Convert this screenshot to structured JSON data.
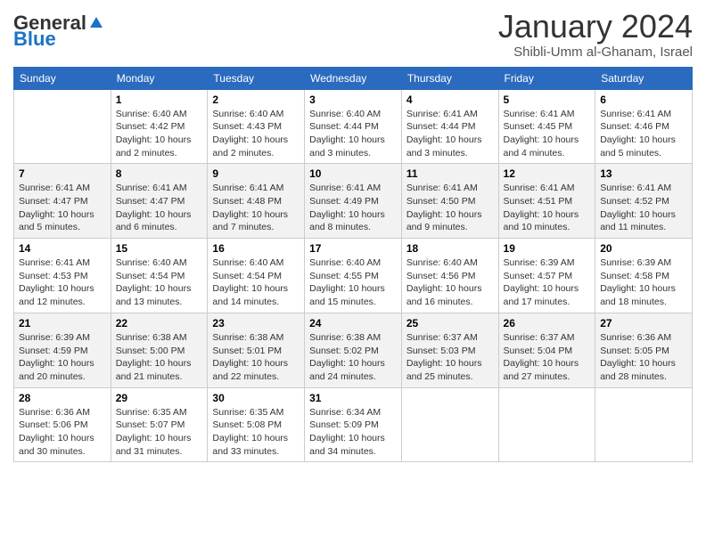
{
  "header": {
    "logo_general": "General",
    "logo_blue": "Blue",
    "month_title": "January 2024",
    "location": "Shibli-Umm al-Ghanam, Israel"
  },
  "days_of_week": [
    "Sunday",
    "Monday",
    "Tuesday",
    "Wednesday",
    "Thursday",
    "Friday",
    "Saturday"
  ],
  "weeks": [
    [
      {
        "day": "",
        "info": ""
      },
      {
        "day": "1",
        "info": "Sunrise: 6:40 AM\nSunset: 4:42 PM\nDaylight: 10 hours\nand 2 minutes."
      },
      {
        "day": "2",
        "info": "Sunrise: 6:40 AM\nSunset: 4:43 PM\nDaylight: 10 hours\nand 2 minutes."
      },
      {
        "day": "3",
        "info": "Sunrise: 6:40 AM\nSunset: 4:44 PM\nDaylight: 10 hours\nand 3 minutes."
      },
      {
        "day": "4",
        "info": "Sunrise: 6:41 AM\nSunset: 4:44 PM\nDaylight: 10 hours\nand 3 minutes."
      },
      {
        "day": "5",
        "info": "Sunrise: 6:41 AM\nSunset: 4:45 PM\nDaylight: 10 hours\nand 4 minutes."
      },
      {
        "day": "6",
        "info": "Sunrise: 6:41 AM\nSunset: 4:46 PM\nDaylight: 10 hours\nand 5 minutes."
      }
    ],
    [
      {
        "day": "7",
        "info": "Sunrise: 6:41 AM\nSunset: 4:47 PM\nDaylight: 10 hours\nand 5 minutes."
      },
      {
        "day": "8",
        "info": "Sunrise: 6:41 AM\nSunset: 4:47 PM\nDaylight: 10 hours\nand 6 minutes."
      },
      {
        "day": "9",
        "info": "Sunrise: 6:41 AM\nSunset: 4:48 PM\nDaylight: 10 hours\nand 7 minutes."
      },
      {
        "day": "10",
        "info": "Sunrise: 6:41 AM\nSunset: 4:49 PM\nDaylight: 10 hours\nand 8 minutes."
      },
      {
        "day": "11",
        "info": "Sunrise: 6:41 AM\nSunset: 4:50 PM\nDaylight: 10 hours\nand 9 minutes."
      },
      {
        "day": "12",
        "info": "Sunrise: 6:41 AM\nSunset: 4:51 PM\nDaylight: 10 hours\nand 10 minutes."
      },
      {
        "day": "13",
        "info": "Sunrise: 6:41 AM\nSunset: 4:52 PM\nDaylight: 10 hours\nand 11 minutes."
      }
    ],
    [
      {
        "day": "14",
        "info": "Sunrise: 6:41 AM\nSunset: 4:53 PM\nDaylight: 10 hours\nand 12 minutes."
      },
      {
        "day": "15",
        "info": "Sunrise: 6:40 AM\nSunset: 4:54 PM\nDaylight: 10 hours\nand 13 minutes."
      },
      {
        "day": "16",
        "info": "Sunrise: 6:40 AM\nSunset: 4:54 PM\nDaylight: 10 hours\nand 14 minutes."
      },
      {
        "day": "17",
        "info": "Sunrise: 6:40 AM\nSunset: 4:55 PM\nDaylight: 10 hours\nand 15 minutes."
      },
      {
        "day": "18",
        "info": "Sunrise: 6:40 AM\nSunset: 4:56 PM\nDaylight: 10 hours\nand 16 minutes."
      },
      {
        "day": "19",
        "info": "Sunrise: 6:39 AM\nSunset: 4:57 PM\nDaylight: 10 hours\nand 17 minutes."
      },
      {
        "day": "20",
        "info": "Sunrise: 6:39 AM\nSunset: 4:58 PM\nDaylight: 10 hours\nand 18 minutes."
      }
    ],
    [
      {
        "day": "21",
        "info": "Sunrise: 6:39 AM\nSunset: 4:59 PM\nDaylight: 10 hours\nand 20 minutes."
      },
      {
        "day": "22",
        "info": "Sunrise: 6:38 AM\nSunset: 5:00 PM\nDaylight: 10 hours\nand 21 minutes."
      },
      {
        "day": "23",
        "info": "Sunrise: 6:38 AM\nSunset: 5:01 PM\nDaylight: 10 hours\nand 22 minutes."
      },
      {
        "day": "24",
        "info": "Sunrise: 6:38 AM\nSunset: 5:02 PM\nDaylight: 10 hours\nand 24 minutes."
      },
      {
        "day": "25",
        "info": "Sunrise: 6:37 AM\nSunset: 5:03 PM\nDaylight: 10 hours\nand 25 minutes."
      },
      {
        "day": "26",
        "info": "Sunrise: 6:37 AM\nSunset: 5:04 PM\nDaylight: 10 hours\nand 27 minutes."
      },
      {
        "day": "27",
        "info": "Sunrise: 6:36 AM\nSunset: 5:05 PM\nDaylight: 10 hours\nand 28 minutes."
      }
    ],
    [
      {
        "day": "28",
        "info": "Sunrise: 6:36 AM\nSunset: 5:06 PM\nDaylight: 10 hours\nand 30 minutes."
      },
      {
        "day": "29",
        "info": "Sunrise: 6:35 AM\nSunset: 5:07 PM\nDaylight: 10 hours\nand 31 minutes."
      },
      {
        "day": "30",
        "info": "Sunrise: 6:35 AM\nSunset: 5:08 PM\nDaylight: 10 hours\nand 33 minutes."
      },
      {
        "day": "31",
        "info": "Sunrise: 6:34 AM\nSunset: 5:09 PM\nDaylight: 10 hours\nand 34 minutes."
      },
      {
        "day": "",
        "info": ""
      },
      {
        "day": "",
        "info": ""
      },
      {
        "day": "",
        "info": ""
      }
    ]
  ]
}
